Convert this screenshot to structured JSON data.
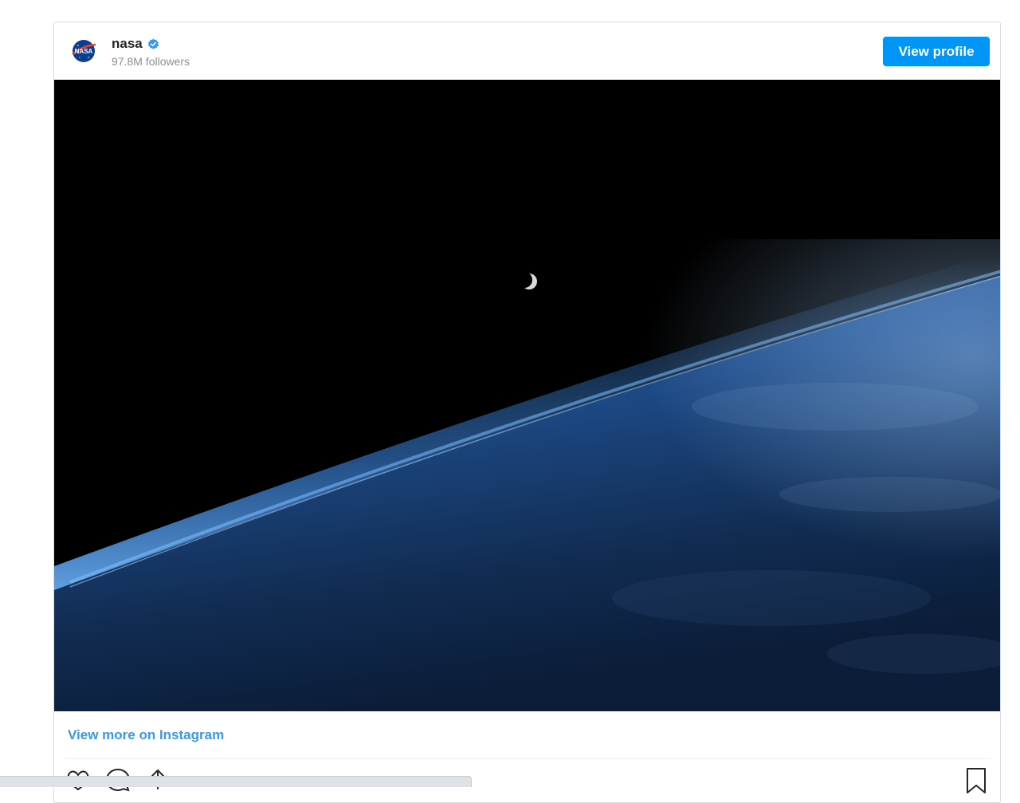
{
  "profile": {
    "username": "nasa",
    "followers": "97.8M followers",
    "verified": true
  },
  "buttons": {
    "view_profile": "View profile"
  },
  "post": {
    "view_more_link": "View more on Instagram"
  },
  "status_bar": {
    "url": ""
  },
  "colors": {
    "accent": "#0095f6",
    "link": "#3897f0",
    "verified_badge": "#3897f0",
    "nasa_logo_blue": "#0b3d91",
    "nasa_logo_red": "#fc3d21"
  },
  "icons": [
    "nasa-logo-icon",
    "verified-badge-icon",
    "heart-icon",
    "comment-icon",
    "share-icon",
    "bookmark-icon"
  ]
}
